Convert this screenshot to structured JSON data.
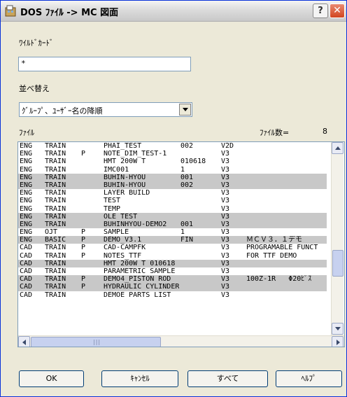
{
  "window": {
    "title": "DOS ﾌｧｲﾙ -> MC 図面",
    "help_label": "?",
    "close_label": "✕"
  },
  "wildcard": {
    "label": "ﾜｲﾙﾄﾞｶｰﾄﾞ",
    "value": "*"
  },
  "sort": {
    "label": "並べ替え",
    "selected": "ｸﾞﾙｰﾌﾟ、ﾕｰｻﾞｰ名の降順"
  },
  "files": {
    "label": "ﾌｧｲﾙ",
    "count_label": "ﾌｧｲﾙ数=",
    "count": "8",
    "rows": [
      {
        "group": "ENG",
        "user": "TRAIN",
        "flag": "",
        "name": "PHAI_TEST",
        "rev": "002",
        "ver": "V2D",
        "note": "",
        "selected": false
      },
      {
        "group": "ENG",
        "user": "TRAIN",
        "flag": "P",
        "name": "NOTE_DIM_TEST-1",
        "rev": "",
        "ver": "V3",
        "note": "",
        "selected": false
      },
      {
        "group": "ENG",
        "user": "TRAIN",
        "flag": "",
        "name": "HMT 200W T",
        "rev": "010618",
        "ver": "V3",
        "note": "",
        "selected": false
      },
      {
        "group": "ENG",
        "user": "TRAIN",
        "flag": "",
        "name": "IMC001",
        "rev": "1",
        "ver": "V3",
        "note": "",
        "selected": false
      },
      {
        "group": "ENG",
        "user": "TRAIN",
        "flag": "",
        "name": "BUHIN-HYOU",
        "rev": "001",
        "ver": "V3",
        "note": "",
        "selected": true
      },
      {
        "group": "ENG",
        "user": "TRAIN",
        "flag": "",
        "name": "BUHIN-HYOU",
        "rev": "002",
        "ver": "V3",
        "note": "",
        "selected": true
      },
      {
        "group": "ENG",
        "user": "TRAIN",
        "flag": "",
        "name": "LAYER BUILD",
        "rev": "",
        "ver": "V3",
        "note": "",
        "selected": false
      },
      {
        "group": "ENG",
        "user": "TRAIN",
        "flag": "",
        "name": "TEST",
        "rev": "",
        "ver": "V3",
        "note": "",
        "selected": false
      },
      {
        "group": "ENG",
        "user": "TRAIN",
        "flag": "",
        "name": "TEMP",
        "rev": "",
        "ver": "V3",
        "note": "",
        "selected": false
      },
      {
        "group": "ENG",
        "user": "TRAIN",
        "flag": "",
        "name": "OLE TEST",
        "rev": "",
        "ver": "V3",
        "note": "",
        "selected": true
      },
      {
        "group": "ENG",
        "user": "TRAIN",
        "flag": "",
        "name": "BUHINHYOU-DEMO2",
        "rev": "001",
        "ver": "V3",
        "note": "",
        "selected": true
      },
      {
        "group": "ENG",
        "user": "OJT",
        "flag": "P",
        "name": "SAMPLE",
        "rev": "1",
        "ver": "V3",
        "note": "",
        "selected": false
      },
      {
        "group": "ENG",
        "user": "BASIC",
        "flag": "P",
        "name": "DEMO_V3.1",
        "rev": "FIN",
        "ver": "V3",
        "note": "ＭＣＶ３．１デモ",
        "selected": true
      },
      {
        "group": "CAD",
        "user": "TRAIN",
        "flag": "P",
        "name": "CAD-CAMPFK",
        "rev": "",
        "ver": "V3",
        "note": "PROGRAMABLE FUNCT",
        "selected": false
      },
      {
        "group": "CAD",
        "user": "TRAIN",
        "flag": "P",
        "name": "NOTES_TTF",
        "rev": "",
        "ver": "V3",
        "note": "FOR TTF DEMO",
        "selected": false
      },
      {
        "group": "CAD",
        "user": "TRAIN",
        "flag": "",
        "name": "HMT 200W T 010618",
        "rev": "",
        "ver": "V3",
        "note": "",
        "selected": true
      },
      {
        "group": "CAD",
        "user": "TRAIN",
        "flag": "",
        "name": "PARAMETRIC SAMPLE",
        "rev": "",
        "ver": "V3",
        "note": "",
        "selected": false
      },
      {
        "group": "CAD",
        "user": "TRAIN",
        "flag": "P",
        "name": "DEMO4_PISTON ROD",
        "rev": "",
        "ver": "V3",
        "note": "100Z-1R   Φ20ﾋﾟｽ",
        "selected": true
      },
      {
        "group": "CAD",
        "user": "TRAIN",
        "flag": "P",
        "name": "HYDRAULIC CYLINDERS",
        "rev": "",
        "ver": "V3",
        "note": "",
        "selected": true
      },
      {
        "group": "CAD",
        "user": "TRAIN",
        "flag": "",
        "name": "DEMOE PARTS LIST",
        "rev": "",
        "ver": "V3",
        "note": "",
        "selected": false
      }
    ]
  },
  "buttons": {
    "ok": "OK",
    "cancel": "ｷｬﾝｾﾙ",
    "all": "すべて",
    "help": "ﾍﾙﾌﾟ"
  },
  "colors": {
    "selection": "#c8c8c8",
    "title_close": "#d2451f"
  }
}
